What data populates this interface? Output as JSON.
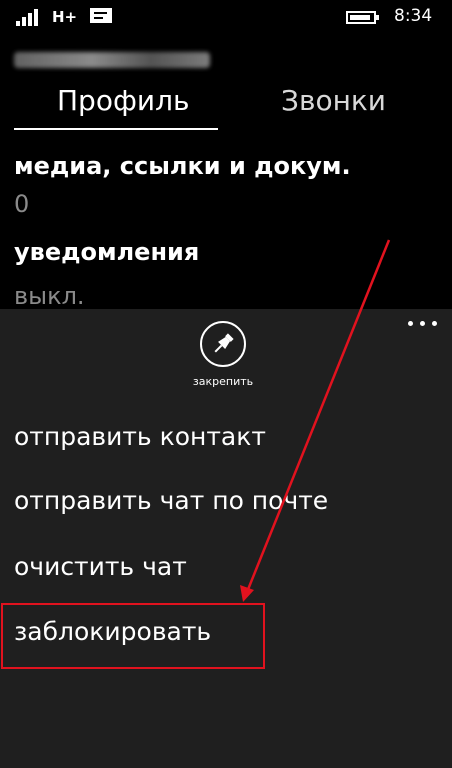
{
  "status_bar": {
    "network": "H+",
    "time": "8:34",
    "icons": [
      "signal-icon",
      "message-icon",
      "battery-icon"
    ]
  },
  "tabs": [
    {
      "label": "Профиль"
    },
    {
      "label": "Звонки"
    }
  ],
  "sections": [
    {
      "title": "медиа, ссылки и докум.",
      "value": "0"
    },
    {
      "title": "уведомления",
      "value": "выкл."
    }
  ],
  "app_bar": {
    "pin_label": "закрепить",
    "more_icon": "ellipsis-icon",
    "pin_icon": "pin-icon",
    "menu_items": [
      {
        "label": "отправить контакт"
      },
      {
        "label": "отправить чат по почте"
      },
      {
        "label": "очистить чат"
      },
      {
        "label": "заблокировать"
      }
    ]
  },
  "colors": {
    "background": "#000000",
    "app_bar_background": "#1f1f1f",
    "secondary_text": "#8a8a8a",
    "annotation": "#e1121e"
  }
}
